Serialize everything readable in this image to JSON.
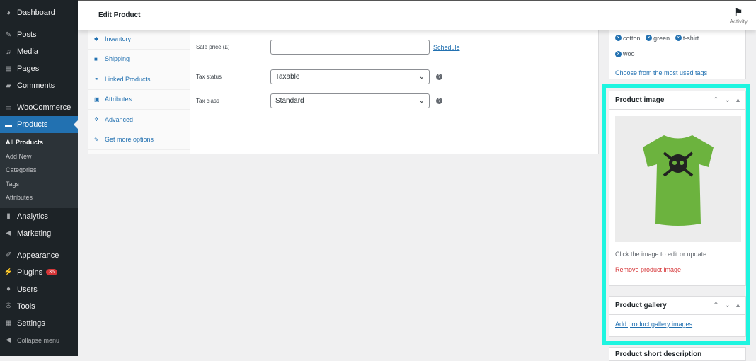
{
  "sidebar": {
    "items": [
      {
        "label": "Dashboard",
        "icon": "dashboard-icon"
      },
      {
        "label": "Posts",
        "icon": "pin-icon"
      },
      {
        "label": "Media",
        "icon": "media-icon"
      },
      {
        "label": "Pages",
        "icon": "pages-icon"
      },
      {
        "label": "Comments",
        "icon": "comment-icon"
      },
      {
        "label": "WooCommerce",
        "icon": "woo-icon"
      },
      {
        "label": "Products",
        "icon": "archive-icon"
      },
      {
        "label": "Analytics",
        "icon": "chart-bar-icon"
      },
      {
        "label": "Marketing",
        "icon": "megaphone-icon"
      },
      {
        "label": "Appearance",
        "icon": "brush-icon"
      },
      {
        "label": "Plugins",
        "icon": "plugin-icon",
        "badge": "36"
      },
      {
        "label": "Users",
        "icon": "user-icon"
      },
      {
        "label": "Tools",
        "icon": "wrench-icon"
      },
      {
        "label": "Settings",
        "icon": "settings-icon"
      },
      {
        "label": "Collapse menu",
        "icon": "collapse-icon"
      }
    ],
    "submenu": [
      "All Products",
      "Add New",
      "Categories",
      "Tags",
      "Attributes"
    ]
  },
  "header": {
    "title": "Edit Product",
    "activity": "Activity"
  },
  "product_data": {
    "tabs": [
      "Inventory",
      "Shipping",
      "Linked Products",
      "Attributes",
      "Advanced",
      "Get more options"
    ],
    "sale_price_label": "Sale price (£)",
    "sale_price_value": "",
    "schedule": "Schedule",
    "tax_status_label": "Tax status",
    "tax_status": "Taxable",
    "tax_class_label": "Tax class",
    "tax_class": "Standard"
  },
  "tags": {
    "items": [
      "cotton",
      "green",
      "t-shirt",
      "woo"
    ],
    "choose": "Choose from the most used tags"
  },
  "product_image": {
    "title": "Product image",
    "hint": "Click the image to edit or update",
    "remove": "Remove product image"
  },
  "gallery": {
    "title": "Product gallery",
    "add": "Add product gallery images"
  },
  "short_desc": {
    "title": "Product short description"
  },
  "colors": {
    "highlight": "#1ef5e0",
    "accent": "#2271b1",
    "shirt": "#6cb33e"
  }
}
